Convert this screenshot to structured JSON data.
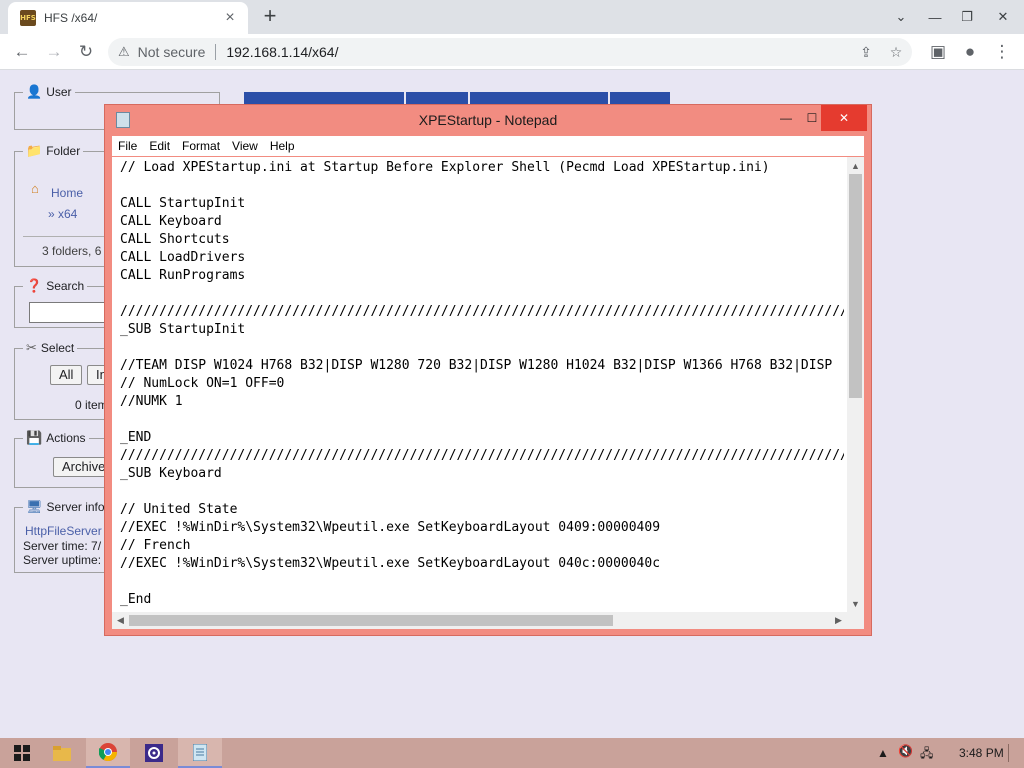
{
  "browser": {
    "tab_title": "HFS /x64/",
    "tab_favicon_text": "HFS",
    "url_warning": "Not secure",
    "url": "192.168.1.14/x64/"
  },
  "hfs": {
    "user_title": "User",
    "folder_title": "Folder",
    "home_link": "Home",
    "breadcrumb_link": "» x64",
    "folder_stats": "3 folders, 6",
    "search_title": "Search",
    "select_title": "Select",
    "select_all": "All",
    "select_invert": "In",
    "items_selected": "0 item",
    "actions_title": "Actions",
    "archive_button": "Archive",
    "server_title": "Server infor",
    "server_link": "HttpFileServer",
    "server_time": "Server time: 7/",
    "server_uptime": "Server uptime:"
  },
  "notepad": {
    "title": "XPEStartup - Notepad",
    "menu": [
      "File",
      "Edit",
      "Format",
      "View",
      "Help"
    ],
    "content": "// Load XPEStartup.ini at Startup Before Explorer Shell (Pecmd Load XPEStartup.ini)\n\nCALL StartupInit\nCALL Keyboard\nCALL Shortcuts\nCALL LoadDrivers\nCALL RunPrograms\n\n//////////////////////////////////////////////////////////////////////////////////////////////////\n_SUB StartupInit\n\n//TEAM DISP W1024 H768 B32|DISP W1280 720 B32|DISP W1280 H1024 B32|DISP W1366 H768 B32|DISP\n// NumLock ON=1 OFF=0\n//NUMK 1\n\n_END\n//////////////////////////////////////////////////////////////////////////////////////////////////\n_SUB Keyboard\n\n// United State\n//EXEC !%WinDir%\\System32\\Wpeutil.exe SetKeyboardLayout 0409:00000409\n// French\n//EXEC !%WinDir%\\System32\\Wpeutil.exe SetKeyboardLayout 040c:0000040c\n\n_End"
  },
  "taskbar": {
    "time": "3:48 PM"
  }
}
